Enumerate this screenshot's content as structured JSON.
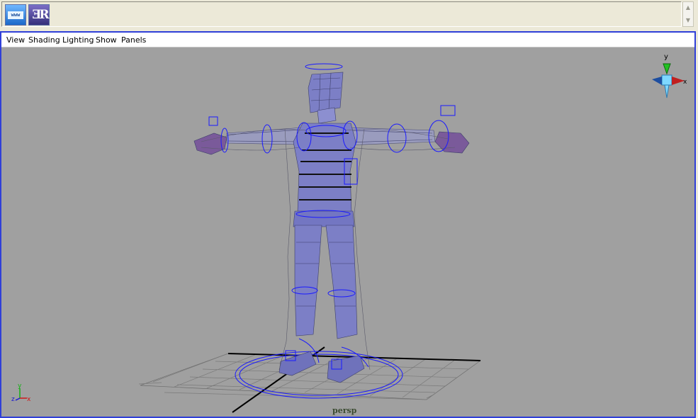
{
  "shelf": {
    "buttons": [
      {
        "name": "www-icon",
        "label": "www"
      },
      {
        "name": "logo-icon",
        "label": "ƎR"
      }
    ]
  },
  "menu": {
    "items": [
      "View",
      "Shading",
      "Lighting",
      "Show",
      "Panels"
    ]
  },
  "viewport": {
    "camera_label": "persp",
    "view_cube_axis_labels": {
      "y": "y",
      "x": "x"
    },
    "origin_axis_labels": {
      "x": "x",
      "y": "y",
      "z": "z"
    }
  },
  "colors": {
    "panel_border": "#2f3fd8",
    "viewport_background": "#a0a0a0",
    "mesh_fill": "#7b7fc8",
    "controls": "#1a1aff"
  }
}
